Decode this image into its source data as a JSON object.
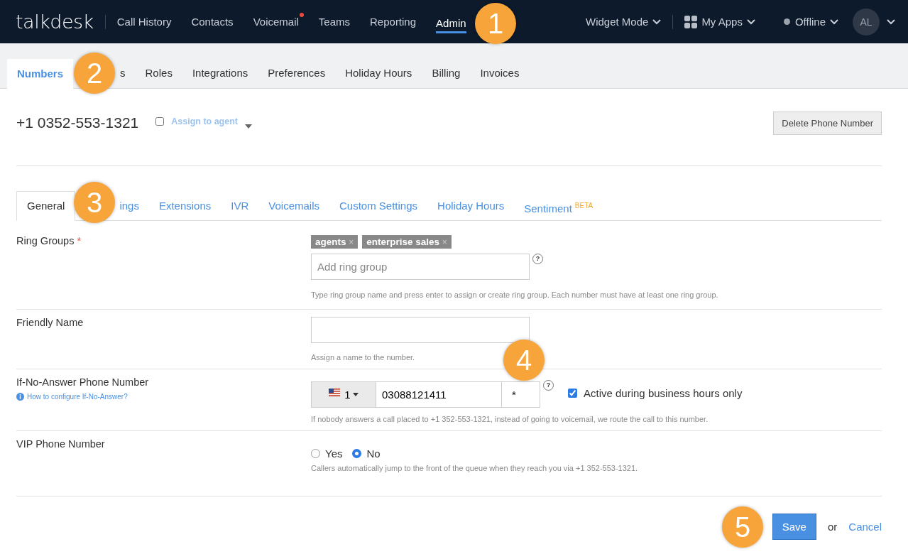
{
  "top_nav": {
    "logo": "talkdesk",
    "items": [
      {
        "label": "Call History",
        "selected": false,
        "notification": false
      },
      {
        "label": "Contacts",
        "selected": false,
        "notification": false
      },
      {
        "label": "Voicemail",
        "selected": false,
        "notification": true
      },
      {
        "label": "Teams",
        "selected": false,
        "notification": false
      },
      {
        "label": "Reporting",
        "selected": false,
        "notification": false
      },
      {
        "label": "Admin",
        "selected": true,
        "notification": false
      }
    ],
    "widget_mode": "Widget Mode",
    "my_apps": "My Apps",
    "status": "Offline",
    "avatar": "AL"
  },
  "admin_tabs": [
    {
      "label": "Numbers",
      "selected": true
    },
    {
      "label": "s",
      "selected": false
    },
    {
      "label": "Roles",
      "selected": false
    },
    {
      "label": "Integrations",
      "selected": false
    },
    {
      "label": "Preferences",
      "selected": false
    },
    {
      "label": "Holiday Hours",
      "selected": false
    },
    {
      "label": "Billing",
      "selected": false
    },
    {
      "label": "Invoices",
      "selected": false
    }
  ],
  "number": {
    "title": "+1 0352-553-1321",
    "assign_checked": false,
    "assign_label": "Assign to agent",
    "delete_button": "Delete Phone Number"
  },
  "number_tabs": [
    {
      "label": "General",
      "selected": true
    },
    {
      "label": "ings",
      "selected": false
    },
    {
      "label": "Extensions",
      "selected": false
    },
    {
      "label": "IVR",
      "selected": false
    },
    {
      "label": "Voicemails",
      "selected": false
    },
    {
      "label": "Custom Settings",
      "selected": false
    },
    {
      "label": "Holiday Hours",
      "selected": false
    },
    {
      "label": "Sentiment",
      "selected": false,
      "badge": "BETA"
    }
  ],
  "ring_groups": {
    "label": "Ring Groups",
    "required": "*",
    "tags": [
      "agents",
      "enterprise sales"
    ],
    "remove": "×",
    "placeholder": "Add ring group",
    "help_icon": "?",
    "help": "Type ring group name and press enter to assign or create ring group. Each number must have at least one ring group."
  },
  "friendly_name": {
    "label": "Friendly Name",
    "help": "Assign a name to the number."
  },
  "if_no_answer": {
    "label": "If-No-Answer Phone Number",
    "link": "How to configure If-No-Answer?",
    "country_code": "1",
    "phone": "03088121411",
    "extension": "*",
    "help_icon": "?",
    "business_hours_checked": true,
    "business_hours_label": "Active during business hours only",
    "help": "If nobody answers a call placed to +1 352-553-1321, instead of going to voicemail, we route the call to this number."
  },
  "vip": {
    "label": "VIP Phone Number",
    "options": [
      {
        "label": "Yes",
        "selected": false
      },
      {
        "label": "No",
        "selected": true
      }
    ],
    "help": "Callers automatically jump to the front of the queue when they reach you via +1 352-553-1321."
  },
  "footer": {
    "save": "Save",
    "or": "or",
    "cancel": "Cancel"
  },
  "callouts": [
    "1",
    "2",
    "3",
    "4",
    "5"
  ]
}
